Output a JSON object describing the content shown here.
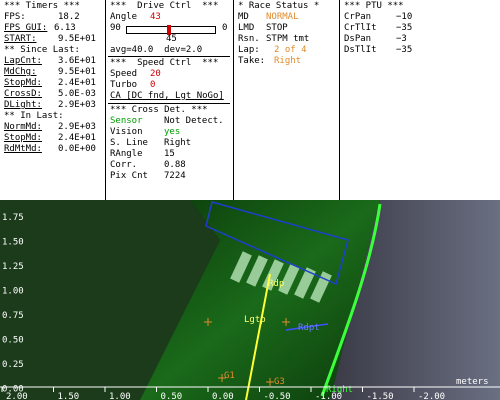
{
  "timers": {
    "title": "*** Timers ***",
    "fps_label": "FPS:",
    "fps_value": "18.2",
    "fps_gui_label": "FPS_GUI:",
    "fps_gui_value": "6.13",
    "start_label": "START:",
    "start_value": "9.5E+01",
    "since_last_title": "** Since Last:",
    "lapcnt_label": "LapCnt:",
    "lapcnt_value": "3.6E+01",
    "mdchg_label": "MdChg:",
    "mdchg_value": "9.5E+01",
    "stopmd_label": "StopMd:",
    "stopmd_value": "2.4E+01",
    "crossd_label": "CrossD:",
    "crossd_value": "5.0E-03",
    "dlight_label": "DLight:",
    "dlight_value": "2.9E+03",
    "in_last_title": "** In Last:",
    "normmd_label": "NormMd:",
    "normmd_value": "2.9E+03",
    "stopmd2_label": "StopMd:",
    "stopmd2_value": "2.4E+01",
    "rdmtmd_label": "RdMtMd:",
    "rdmtmd_value": "0.0E+00"
  },
  "drive": {
    "title": "***  Drive Ctrl  ***",
    "angle_label": "Angle",
    "angle_value": "43",
    "slider_min": "90",
    "slider_max": "0",
    "slider_current": "45",
    "slider_fraction": 0.48,
    "avg_text": "avg=40.0  dev=2.0",
    "speed_title": "***  Speed Ctrl  ***",
    "speed_label": "Speed",
    "speed_value": "20",
    "turbo_label": "Turbo",
    "turbo_value": "0",
    "ca_text": "CA [DC fnd, Lgt NoGo]",
    "cross_title": "*** Cross Det. ***",
    "sensor_label": "Sensor",
    "sensor_value": "Not Detect.",
    "vision_label": "Vision",
    "vision_value": "yes",
    "sline_label": "S. Line",
    "sline_value": "Right",
    "rangle_label": "RAngle",
    "rangle_value": "15",
    "corr_label": "Corr.",
    "corr_value": "0.88",
    "pixcnt_label": "Pix Cnt",
    "pixcnt_value": "7224"
  },
  "race": {
    "title": "* Race Status *",
    "md_label": "MD",
    "md_value": "NORMAL",
    "lmd_label": "LMD",
    "lmd_value": "STOP",
    "rsn_label": "Rsn.",
    "rsn_value": "STPM tmt",
    "lap_label": "Lap:",
    "lap_value": "2 of 4",
    "take_label": "Take:",
    "take_value": "Right"
  },
  "ptu": {
    "title": "*** PTU ***",
    "crpan_label": "CrPan",
    "crpan_value": "−10",
    "crtilt_label": "CrTlIt",
    "crtilt_value": "−35",
    "dspan_label": "DsPan",
    "dspan_value": "−3",
    "dstilt_label": "DsTlIt",
    "dstilt_value": "−35"
  },
  "camera": {
    "y_ticks": [
      "1.75",
      "1.50",
      "1.25",
      "1.00",
      "0.75",
      "0.50",
      "0.25",
      "0.00"
    ],
    "x_ticks": [
      "2.00",
      "1.50",
      "1.00",
      "0.50",
      "0.00",
      "-0.50",
      "-1.00",
      "-1.50",
      "-2.00"
    ],
    "units_label": "meters",
    "label_rdp": "Rdp",
    "label_lgtp": "Lgtp",
    "label_rdpt": "Rdpt",
    "label_g1": "G1",
    "label_g3": "G3",
    "label_right": "Right"
  },
  "colors": {
    "angle_red": "#d00000",
    "orange": "#e08a2a",
    "green": "#00a000",
    "blue": "#1d3fd0"
  }
}
